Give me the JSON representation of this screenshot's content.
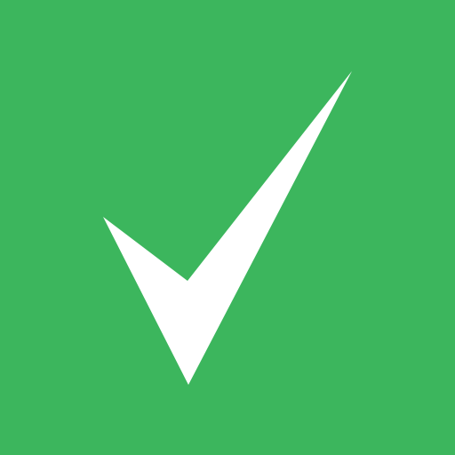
{
  "icon": {
    "name": "checkmark-icon",
    "background_color": "#3CB65D",
    "mark_color": "#FFFFFF"
  }
}
